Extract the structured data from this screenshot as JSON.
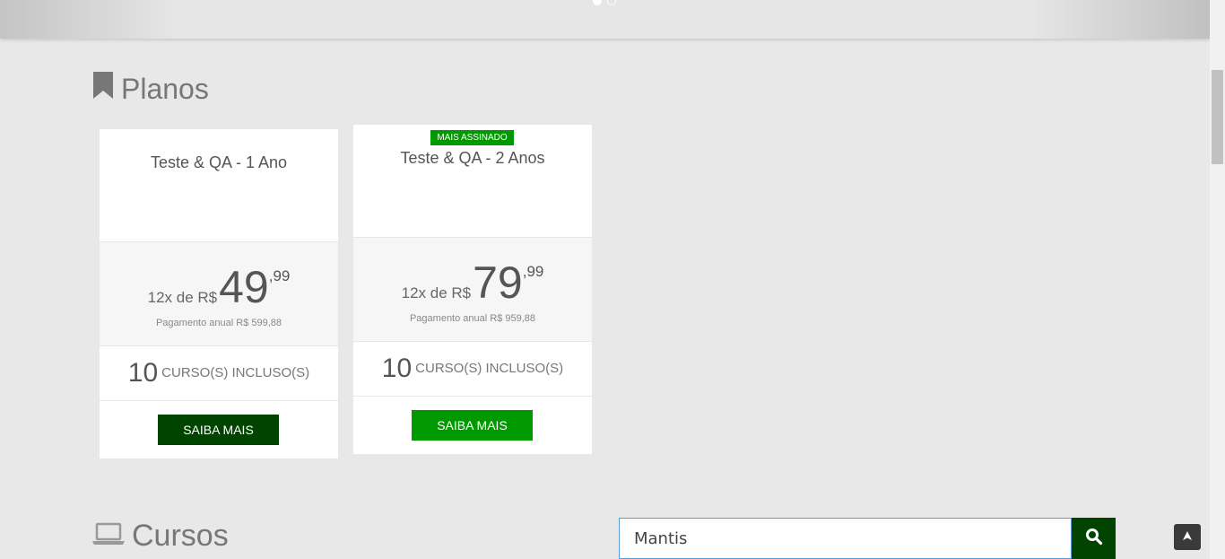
{
  "carousel": {
    "slide_count": 2,
    "active_index": 0
  },
  "planos": {
    "title": "Planos",
    "icon": "bookmark-icon",
    "plans": [
      {
        "name": "Teste & QA - 1 Ano",
        "badge": "",
        "installments": "12x de R$",
        "price_int": "49",
        "price_cents": ",99",
        "annual": "Pagamento anual R$ 599,88",
        "courses_count": "10",
        "courses_label": "CURSO(S) INCLUSO(S)",
        "button": "SAIBA MAIS",
        "button_color": "#004400"
      },
      {
        "name": "Teste & QA - 2 Anos",
        "badge": "MAIS ASSINADO",
        "installments": "12x de R$",
        "price_int": "79",
        "price_cents": ",99",
        "annual": "Pagamento anual R$ 959,88",
        "courses_count": "10",
        "courses_label": "CURSO(S) INCLUSO(S)",
        "button": "SAIBA MAIS",
        "button_color": "#009900"
      }
    ]
  },
  "cursos": {
    "title": "Cursos",
    "icon": "laptop-icon",
    "search": {
      "value": "Mantis",
      "button_icon": "search-icon"
    }
  },
  "scroll_top_icon": "arrow-up-icon",
  "colors": {
    "dark_green": "#004400",
    "green": "#009900",
    "background": "#e8e8e8"
  }
}
